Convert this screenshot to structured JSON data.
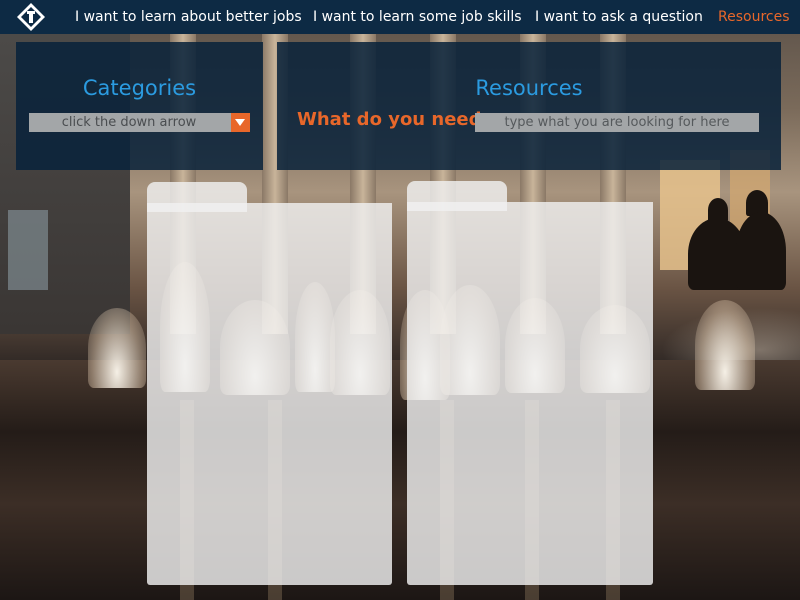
{
  "nav": {
    "items": [
      {
        "label": "I want to learn about better jobs"
      },
      {
        "label": "I want to learn some job skills"
      },
      {
        "label": "I want to ask a question"
      },
      {
        "label": "Resources"
      }
    ],
    "active_index": 3
  },
  "categories": {
    "title": "Categories",
    "select_text": "click the down arrow"
  },
  "resources": {
    "title": "Resources",
    "need_label": "What do you need:",
    "search_placeholder": "type what you are looking for here"
  },
  "colors": {
    "nav_bg": "#0d2a44",
    "accent": "#e8672a",
    "title_blue": "#2b9be0",
    "input_gray": "#a3a6a8"
  },
  "icons": {
    "logo": "lightbulb-logo-icon",
    "dropdown": "triangle-down-icon"
  }
}
